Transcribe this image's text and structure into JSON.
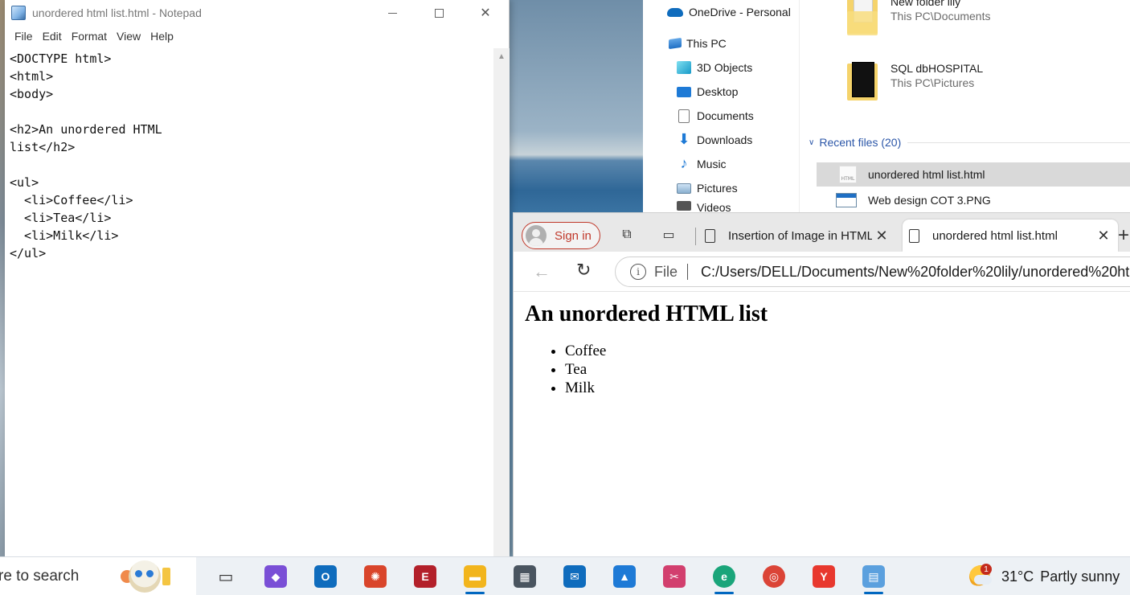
{
  "notepad": {
    "title": "unordered html list.html - Notepad",
    "menu": [
      "File",
      "Edit",
      "Format",
      "View",
      "Help"
    ],
    "content": "<DOCTYPE html>\n<html>\n<body>\n\n<h2>An unordered HTML\nlist</h2>\n\n<ul>\n  <li>Coffee</li>\n  <li>Tea</li>\n  <li>Milk</li>\n</ul>"
  },
  "explorer": {
    "nav": {
      "onedrive": "OneDrive - Personal",
      "this_pc": "This PC",
      "objects3d": "3D Objects",
      "desktop": "Desktop",
      "documents": "Documents",
      "downloads": "Downloads",
      "music": "Music",
      "pictures": "Pictures",
      "videos": "Videos"
    },
    "folders": [
      {
        "name": "New folder lily",
        "path": "This PC\\Documents"
      },
      {
        "name": "SQL dbHOSPITAL",
        "path": "This PC\\Pictures"
      }
    ],
    "recent_header": "Recent files (20)",
    "recent": [
      {
        "name": "unordered html list.html",
        "icon": "html-file-icon",
        "selected": true
      },
      {
        "name": "Web design COT 3.PNG",
        "icon": "png-file-icon",
        "selected": false
      }
    ]
  },
  "browser": {
    "sign_in": "Sign in",
    "tabs": [
      {
        "label": "Insertion of Image in HTML",
        "active": false
      },
      {
        "label": "unordered html list.html",
        "active": true
      }
    ],
    "address_scheme": "File",
    "address": "C:/Users/DELL/Documents/New%20folder%20lily/unordered%20ht...",
    "page": {
      "heading": "An unordered HTML list",
      "items": [
        "Coffee",
        "Tea",
        "Milk"
      ]
    }
  },
  "taskbar": {
    "search_text": "re to search",
    "apps": [
      {
        "name": "task-view",
        "color": "#333333",
        "glyph": "▭",
        "open": false
      },
      {
        "name": "copilot",
        "color": "#7a4fd6",
        "glyph": "◆",
        "open": false
      },
      {
        "name": "outlook",
        "color": "#0f6cbd",
        "glyph": "O",
        "open": false
      },
      {
        "name": "app-red",
        "color": "#d9452b",
        "glyph": "✺",
        "open": false
      },
      {
        "name": "ecu",
        "color": "#b3202a",
        "glyph": "E",
        "open": false
      },
      {
        "name": "file-explorer",
        "color": "#f2b51d",
        "glyph": "▬",
        "open": true
      },
      {
        "name": "calculator",
        "color": "#4a5560",
        "glyph": "▦",
        "open": false
      },
      {
        "name": "mail",
        "color": "#0f6cbd",
        "glyph": "✉",
        "open": false
      },
      {
        "name": "azure",
        "color": "#1e7ad6",
        "glyph": "▲",
        "open": false
      },
      {
        "name": "snipping-tool",
        "color": "#d23f6e",
        "glyph": "✂",
        "open": false
      },
      {
        "name": "edge",
        "color": "#1aa57a",
        "glyph": "e",
        "open": true
      },
      {
        "name": "chrome",
        "color": "#db4437",
        "glyph": "◎",
        "open": false
      },
      {
        "name": "yandex",
        "color": "#e8382e",
        "glyph": "Y",
        "open": false
      },
      {
        "name": "notepad",
        "color": "#5ba0de",
        "glyph": "▤",
        "open": true
      }
    ],
    "weather": {
      "badge": "1",
      "temp": "31°C",
      "condition": "Partly sunny"
    }
  }
}
